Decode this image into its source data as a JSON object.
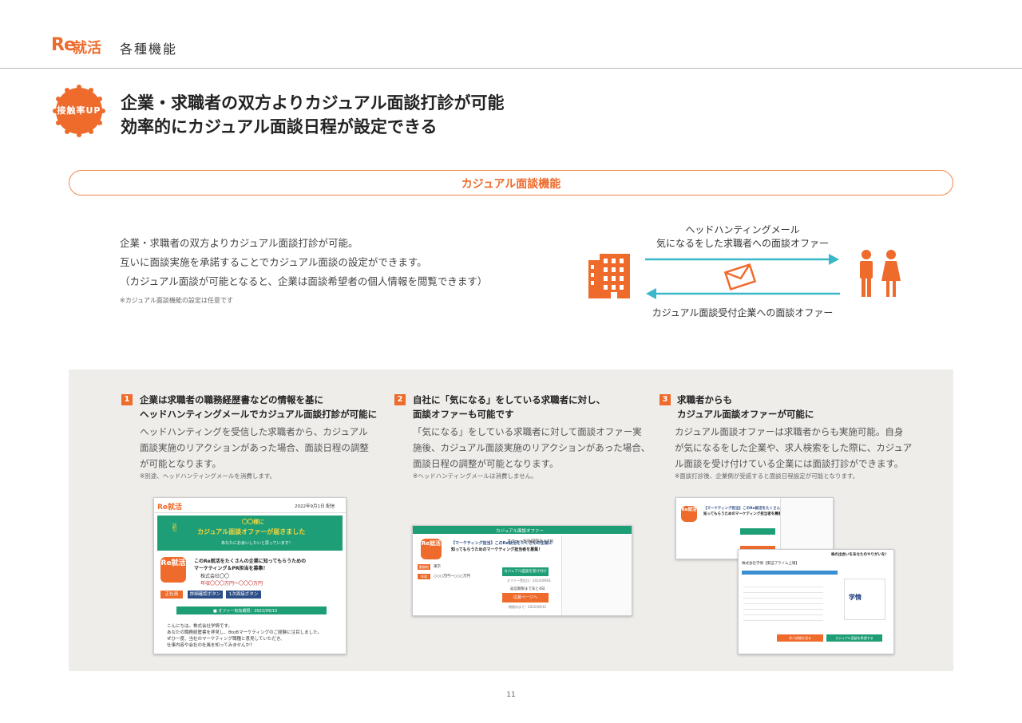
{
  "header": {
    "logo_re": "Re",
    "logo_kj": "就活",
    "subtitle": "各種機能"
  },
  "badge": {
    "label": "接触率UP"
  },
  "headline": {
    "line1": "企業・求職者の双方よりカジュアル面談打診が可能",
    "line2": "効率的にカジュアル面談日程が設定できる"
  },
  "section_label": "カジュアル面談機能",
  "intro": {
    "lines": [
      "企業・求職者の双方よりカジュアル面談打診が可能。",
      "互いに面談実施を承諾することでカジュアル面談の設定ができます。",
      "（カジュアル面談が可能となると、企業は面談希望者の個人情報を閲覧できます）"
    ],
    "note": "※カジュアル面談機能の設定は任意です"
  },
  "diagram": {
    "top_line1": "ヘッドハンティングメール",
    "top_line2": "気になるをした求職者への面談オファー",
    "bottom": "カジュアル面談受付企業への面談オファー",
    "colors": {
      "orange": "#ee6b2c",
      "teal": "#3ab7c8"
    }
  },
  "columns": [
    {
      "num": "1",
      "title1": "企業は求職者の職務経歴書などの情報を基に",
      "title2": "ヘッドハンティングメールでカジュアル面談打診が可能に",
      "body1": "ヘッドハンティングを受信した求職者から、カジュアル",
      "body2": "面談実施のリアクションがあった場合、面談日程の調整",
      "body3": "が可能となります。",
      "note": "※別途、ヘッドハンティングメールを消費します。"
    },
    {
      "num": "2",
      "title1": "自社に「気になる」をしている求職者に対し、",
      "title2": "面談オファーも可能です",
      "body1": "「気になる」をしている求職者に対して面談オファー実",
      "body2": "施後、カジュアル面談実施のリアクションがあった場合、",
      "body3": "面談日程の調整が可能となります。",
      "note": "※ヘッドハンティングメールは消費しません。"
    },
    {
      "num": "3",
      "title1": "求職者からも",
      "title2": "カジュアル面談オファーが可能に",
      "body1": "カジュアル面談オファーは求職者からも実施可能。自身",
      "body2": "が気になるをした企業や、求人検索をした際に、カジュア",
      "body3": "ル面談を受け付けている企業には面談打診ができます。",
      "note": "※面談打診後、企業側が受諾すると面談日程設定が可能となります。"
    }
  ],
  "mock1": {
    "logo": "Re就活",
    "date": "2022年9月1日 配信",
    "banner1": "〇〇様に",
    "banner2": "カジュアル面談オファーが届きました",
    "banner3": "あなたにお会いしたいと思っています！",
    "icon": "Re就活",
    "job1": "このRe就活をたくさんの企業に知ってもらうための",
    "job2": "マーケティング＆PR担当を募集！",
    "company": "株式会社〇〇",
    "salary": "年収〇〇〇万円〜〇〇〇万円",
    "tag": "正社員",
    "btn1": "詳細確認ボタン",
    "btn2": "1次面接ボタン",
    "deadline": "■ オファー有効期限：2022/09/10",
    "msg1": "こんにちは。株式会社学情です。",
    "msg2": "あなたの職務経歴書を拝見し、BtoBマーケティングのご経験に注目しました。",
    "msg3": "ぜひ一度、当社のマーケティング職種と意見していただき、",
    "msg4": "仕事内容や会社の社風を知ってみませんか？"
  },
  "mock2": {
    "header": "カジュアル面談オファー",
    "icon": "Re就活",
    "title1": "【マーケティング担当】このRe就活をたくさんの企業に",
    "title2": "知ってもらうためのマーケティング担当者を募集！",
    "tag1": "勤務地",
    "tag2": "年収",
    "val1": "東京",
    "val2": "○○○万円〜○○○万円",
    "expiry": "オファー有効期限あと7日",
    "btn_green": "カジュアル面談を受け付ける",
    "small1": "オファー受信日：2022/09/01",
    "reply": "返信期限まであと4日",
    "btn_orange": "応募ページへ",
    "small2": "期限内まで：2022/09/12"
  },
  "mock3": {
    "icon": "Re就活",
    "title1": "【マーケティング担当】このRe就活をたくさんの企業に",
    "title2": "知ってもらうためのマーケティング担当者を募集！",
    "b_header": "株の出会いをあなたのやりがいを!",
    "b_company": "株式会社学情【東証プライム上場】",
    "b_logo": "学情",
    "btn_orange": "求人詳細を見る",
    "btn_green": "カジュアル面談を希望する"
  },
  "page_number": "11"
}
